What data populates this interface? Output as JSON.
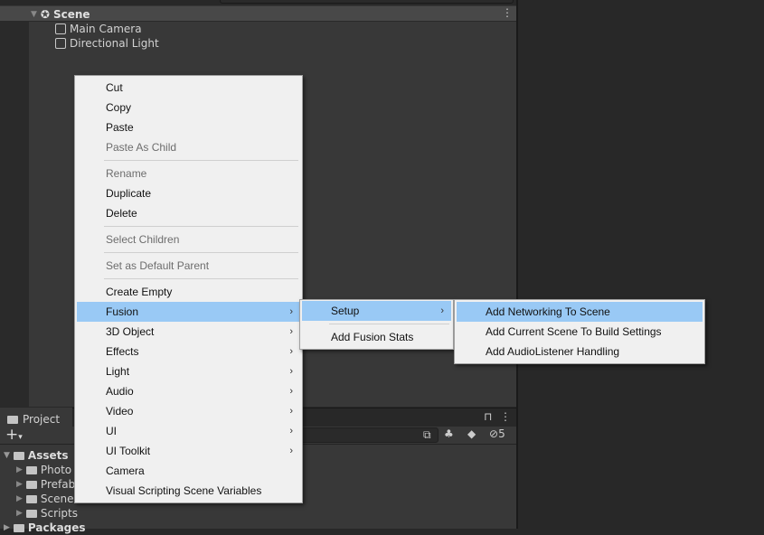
{
  "hierarchy": {
    "scene": "Scene",
    "items": [
      "Main Camera",
      "Directional Light"
    ]
  },
  "project": {
    "tab": "Project",
    "hidden_count": "5",
    "tree": [
      {
        "label": "Assets",
        "children": [
          "Photo",
          "Prefab",
          "Scene",
          "Scripts"
        ]
      },
      {
        "label": "Packages"
      }
    ]
  },
  "context_menu": {
    "items": [
      {
        "label": "Cut"
      },
      {
        "label": "Copy"
      },
      {
        "label": "Paste"
      },
      {
        "label": "Paste As Child",
        "disabled": true
      },
      {
        "sep": true
      },
      {
        "label": "Rename",
        "disabled": true
      },
      {
        "label": "Duplicate"
      },
      {
        "label": "Delete"
      },
      {
        "sep": true
      },
      {
        "label": "Select Children",
        "disabled": true
      },
      {
        "sep": true
      },
      {
        "label": "Set as Default Parent",
        "disabled": true
      },
      {
        "sep": true
      },
      {
        "label": "Create Empty"
      },
      {
        "label": "Fusion",
        "submenu": true,
        "highlighted": true
      },
      {
        "label": "3D Object",
        "submenu": true
      },
      {
        "label": "Effects",
        "submenu": true
      },
      {
        "label": "Light",
        "submenu": true
      },
      {
        "label": "Audio",
        "submenu": true
      },
      {
        "label": "Video",
        "submenu": true
      },
      {
        "label": "UI",
        "submenu": true
      },
      {
        "label": "UI Toolkit",
        "submenu": true
      },
      {
        "label": "Camera"
      },
      {
        "label": "Visual Scripting Scene Variables"
      }
    ]
  },
  "fusion_menu": {
    "items": [
      {
        "label": "Setup",
        "submenu": true,
        "highlighted": true
      },
      {
        "sep": true
      },
      {
        "label": "Add Fusion Stats"
      }
    ]
  },
  "setup_menu": {
    "items": [
      {
        "label": "Add Networking To Scene",
        "highlighted": true
      },
      {
        "label": "Add Current Scene To Build Settings"
      },
      {
        "label": "Add AudioListener Handling"
      }
    ]
  },
  "colors": {
    "highlight": "#99c9f5",
    "menu_bg": "#f0f0f0",
    "panel_bg": "#383838"
  }
}
